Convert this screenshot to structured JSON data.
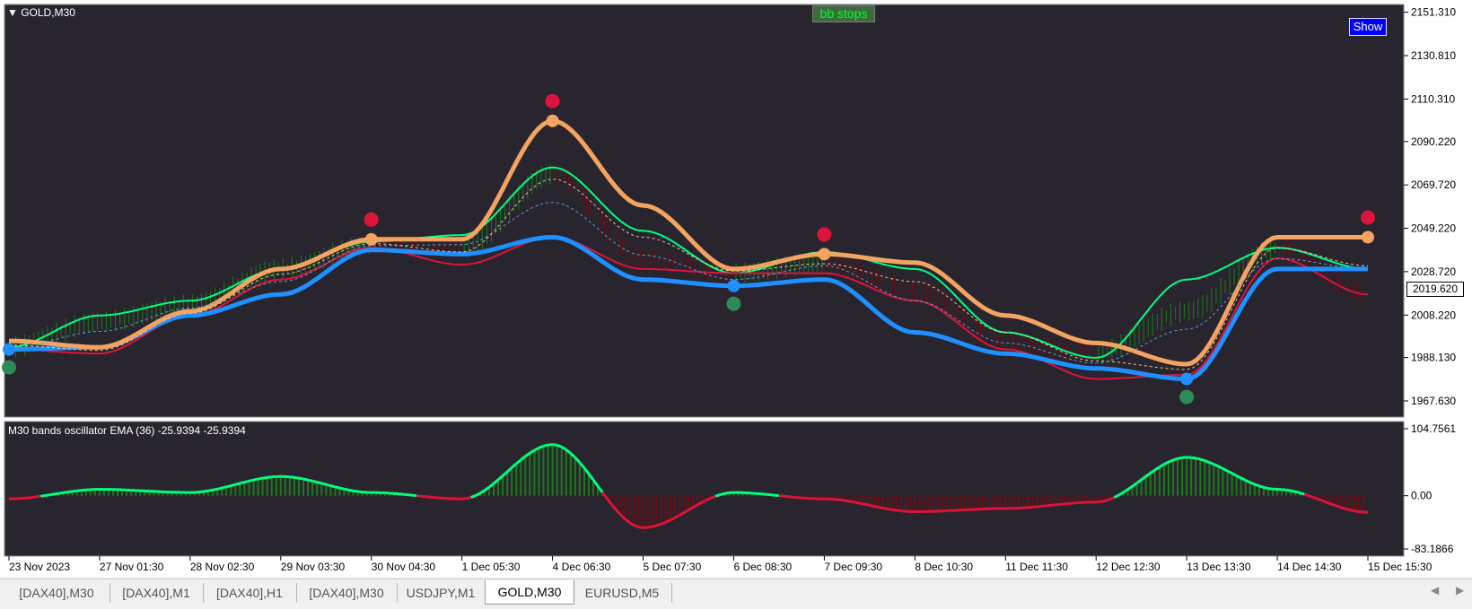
{
  "symbol": "GOLD,M30",
  "buttons": {
    "bb_stops": "bb stops",
    "show": "Show"
  },
  "current_price": "2019.620",
  "price_axis": [
    "2151.310",
    "2130.810",
    "2110.310",
    "2090.220",
    "2069.720",
    "2049.220",
    "2028.720",
    "2008.220",
    "1988.130",
    "1967.630"
  ],
  "indicator": {
    "label": "M30 bands oscillator EMA (36)  -25.9394 -25.9394",
    "axis": [
      "104.7561",
      "0.00",
      "-83.1866"
    ]
  },
  "time_axis": [
    "23 Nov 2023",
    "27 Nov 01:30",
    "28 Nov 02:30",
    "29 Nov 03:30",
    "30 Nov 04:30",
    "1 Dec 05:30",
    "4 Dec 06:30",
    "5 Dec 07:30",
    "6 Dec 08:30",
    "7 Dec 09:30",
    "8 Dec 10:30",
    "11 Dec 11:30",
    "12 Dec 12:30",
    "13 Dec 13:30",
    "14 Dec 14:30",
    "15 Dec 15:30"
  ],
  "tabs": [
    {
      "label": "[DAX40],M30",
      "active": false
    },
    {
      "label": "[DAX40],M1",
      "active": false
    },
    {
      "label": "[DAX40],H1",
      "active": false
    },
    {
      "label": "[DAX40],M30",
      "active": false
    },
    {
      "label": "USDJPY,M1",
      "active": false
    },
    {
      "label": "GOLD,M30",
      "active": true
    },
    {
      "label": "EURUSD,M5",
      "active": false
    }
  ],
  "colors": {
    "background": "#29252f",
    "up_candle": "#1a7a1a",
    "down_candle": "#6e0c12",
    "upper_band": "#00ff7f",
    "lower_band": "#dc143c",
    "long_stop": "#1e90ff",
    "short_stop": "#f4a460",
    "osc_up": "#00ff7f",
    "osc_down": "#dc143c"
  },
  "chart_data": {
    "type": "line",
    "title": "GOLD,M30",
    "x": [
      "23 Nov 2023",
      "27 Nov 01:30",
      "28 Nov 02:30",
      "29 Nov 03:30",
      "30 Nov 04:30",
      "1 Dec 05:30",
      "4 Dec 06:30",
      "5 Dec 07:30",
      "6 Dec 08:30",
      "7 Dec 09:30",
      "8 Dec 10:30",
      "11 Dec 11:30",
      "12 Dec 12:30",
      "13 Dec 13:30",
      "14 Dec 14:30",
      "15 Dec 15:30"
    ],
    "ylim": [
      1960,
      2155
    ],
    "series": [
      {
        "values": [
          1993,
          2005,
          2013,
          2030,
          2041,
          2040,
          2075,
          2035,
          2028,
          2033,
          2020,
          1995,
          1990,
          2010,
          2040,
          2018
        ]
      },
      {
        "values": [
          1993,
          2008,
          2015,
          2030,
          2043,
          2046,
          2078,
          2048,
          2028,
          2038,
          2030,
          2000,
          1988,
          2025,
          2040,
          2030
        ]
      },
      {
        "values": [
          1992,
          1990,
          2008,
          2025,
          2040,
          2032,
          2045,
          2030,
          2028,
          2028,
          2015,
          1992,
          1978,
          1980,
          2035,
          2018
        ]
      },
      {
        "values": [
          1992,
          1993,
          2008,
          2018,
          2039,
          2037,
          2045,
          2025,
          2022,
          2025,
          2000,
          1990,
          1983,
          1978,
          2030,
          2030
        ]
      },
      {
        "values": [
          1996,
          1993,
          2010,
          2030,
          2044,
          2044,
          2100,
          2060,
          2030,
          2037,
          2033,
          2008,
          1995,
          1985,
          2045,
          2045
        ]
      }
    ],
    "oscillator": {
      "ylim": [
        -83.1866,
        104.7561
      ],
      "values": [
        -5,
        10,
        5,
        30,
        5,
        -5,
        80,
        -50,
        5,
        -5,
        -25,
        -20,
        -10,
        60,
        10,
        -26
      ]
    }
  }
}
